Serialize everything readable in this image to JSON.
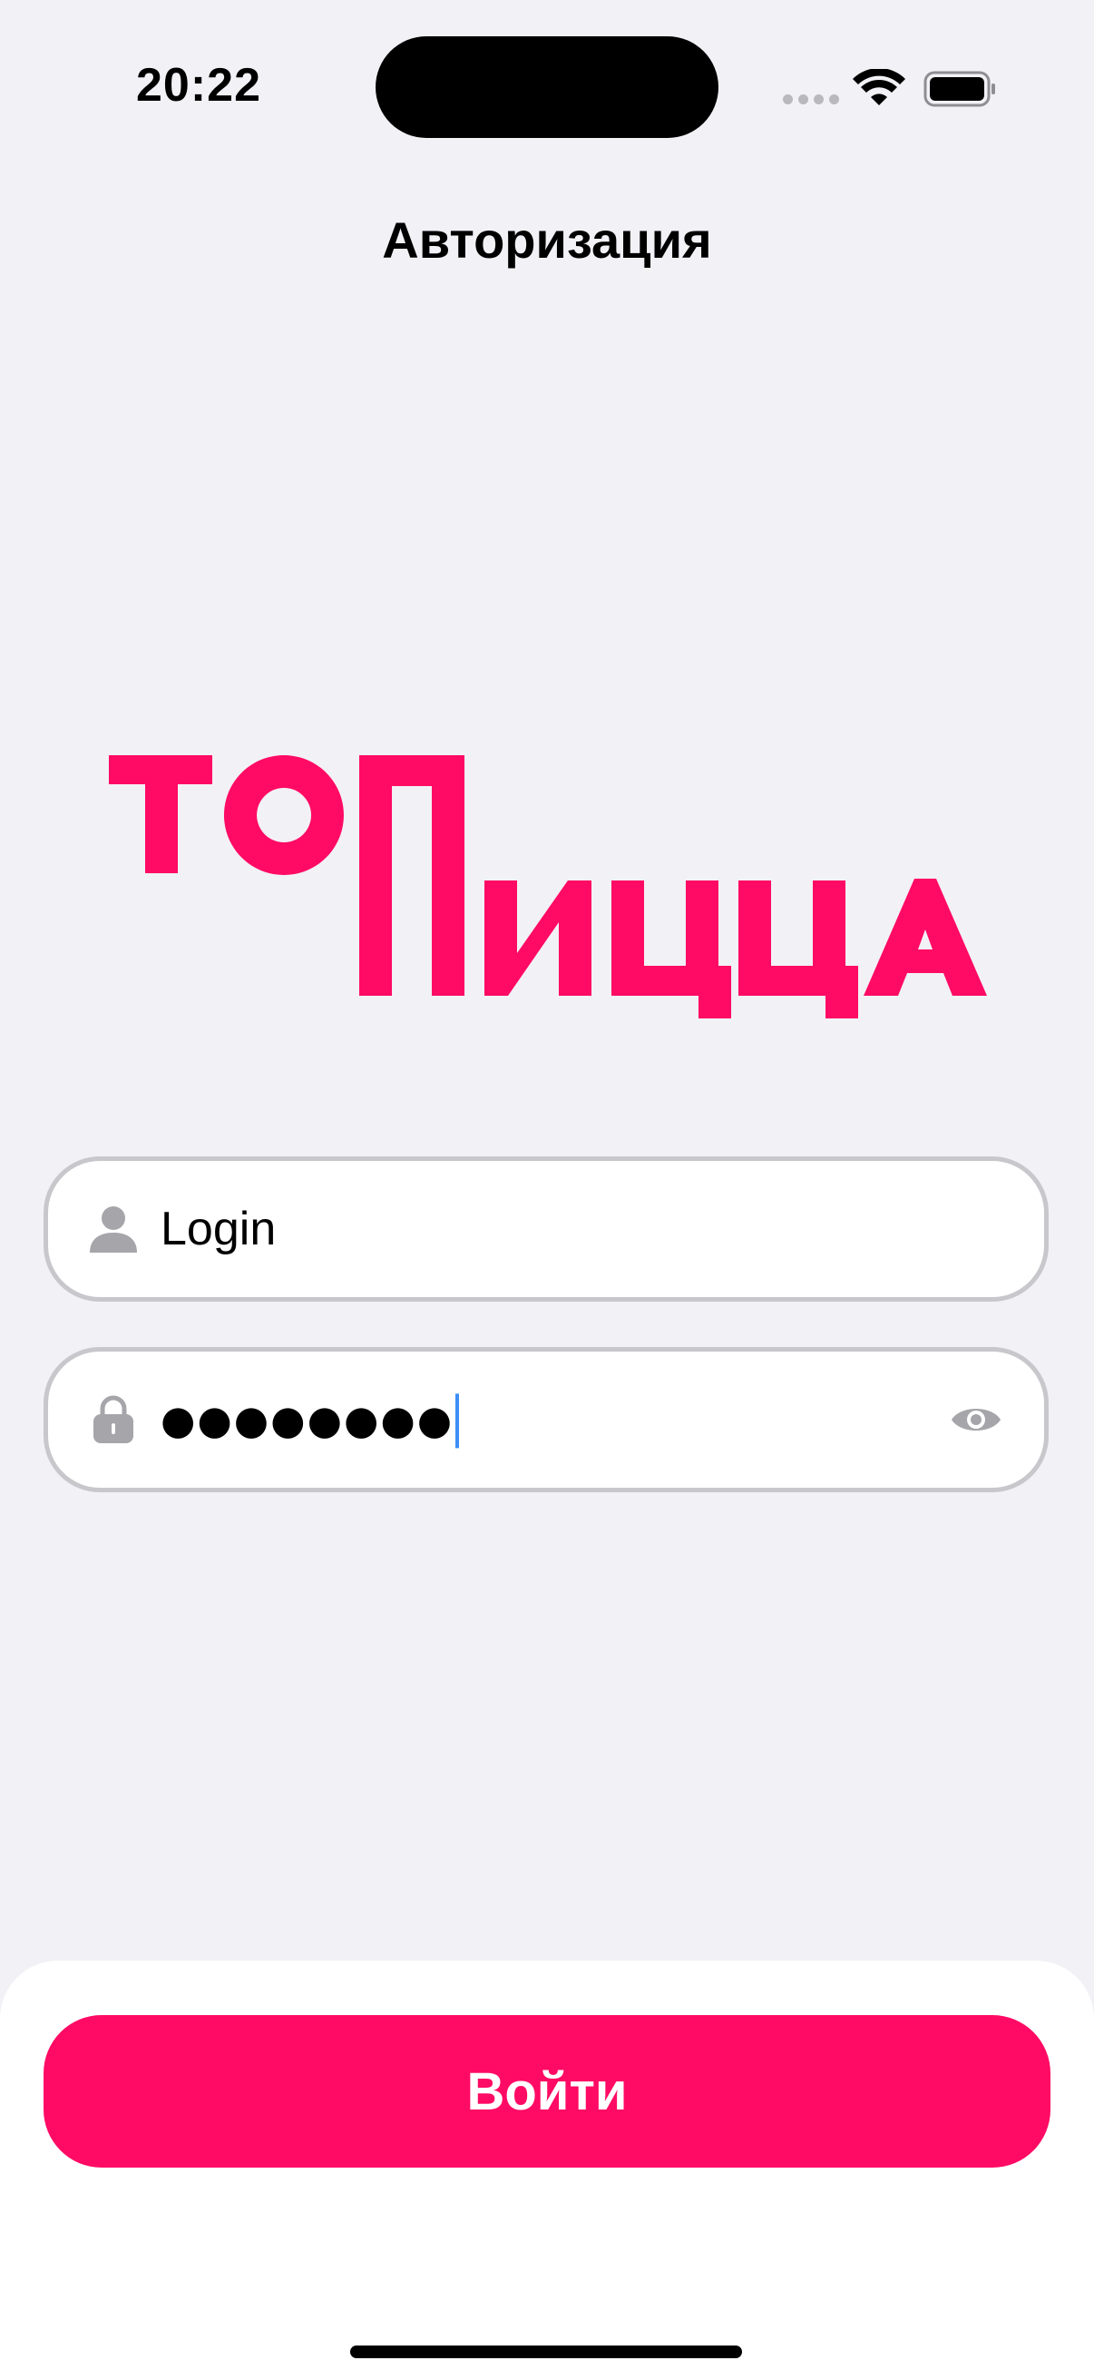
{
  "status_bar": {
    "time": "20:22"
  },
  "nav": {
    "title": "Авторизация"
  },
  "logo": {
    "line1": "ТО",
    "line2": "ПИЦЦА",
    "brand_color": "#ff0a64"
  },
  "login_field": {
    "value": "Login",
    "icon": "person-icon"
  },
  "password_field": {
    "value": "●●●●●●●●",
    "icon": "lock-icon",
    "toggle_icon": "eye-icon"
  },
  "actions": {
    "submit_label": "Войти"
  },
  "colors": {
    "accent": "#ff0a64",
    "background": "#f2f1f6"
  }
}
